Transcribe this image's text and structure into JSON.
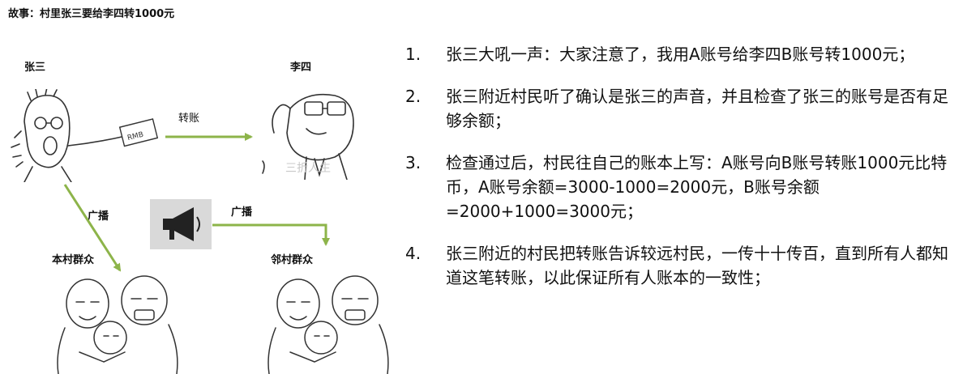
{
  "title": "故事：村里张三要给李四转1000元",
  "nodes": {
    "zhangsan": "张三",
    "lisi": "李四",
    "local_villagers": "本村群众",
    "neighbor_villagers": "邻村群众"
  },
  "edges": {
    "transfer": "转账",
    "broadcast_left": "广播",
    "broadcast_right": "广播"
  },
  "watermark": "三折人生",
  "banknote_text": "RMB",
  "colors": {
    "arrow": "#8db44a",
    "megaphone_bg": "#d9d9d9",
    "sketch": "#333333"
  },
  "steps": [
    {
      "num": "1.",
      "text": "张三大吼一声：大家注意了，我用A账号给李四B账号转1000元；"
    },
    {
      "num": "2.",
      "text": "张三附近村民听了确认是张三的声音，并且检查了张三的账号是否有足够余额；"
    },
    {
      "num": "3.",
      "text": "检查通过后，村民往自己的账本上写：A账号向B账号转账1000元比特币，A账号余额=3000-1000=2000元，B账号余额=2000+1000=3000元；"
    },
    {
      "num": "4.",
      "text": "张三附近的村民把转账告诉较远村民，一传十十传百，直到所有人都知道这笔转账，以此保证所有人账本的一致性；"
    }
  ]
}
